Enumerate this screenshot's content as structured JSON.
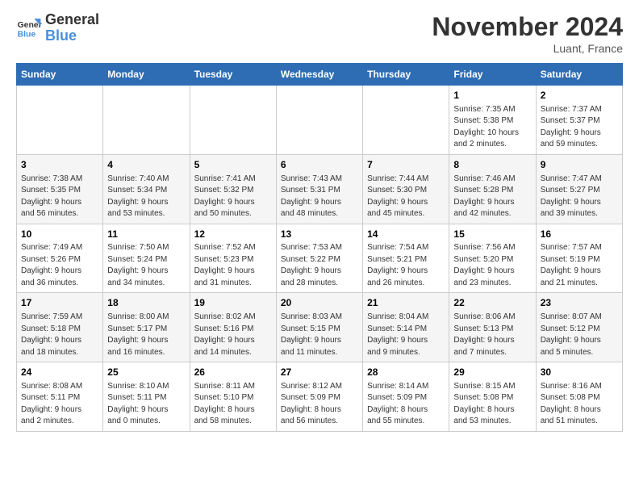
{
  "logo": {
    "line1": "General",
    "line2": "Blue"
  },
  "title": "November 2024",
  "location": "Luant, France",
  "weekdays": [
    "Sunday",
    "Monday",
    "Tuesday",
    "Wednesday",
    "Thursday",
    "Friday",
    "Saturday"
  ],
  "weeks": [
    [
      {
        "day": "",
        "info": ""
      },
      {
        "day": "",
        "info": ""
      },
      {
        "day": "",
        "info": ""
      },
      {
        "day": "",
        "info": ""
      },
      {
        "day": "",
        "info": ""
      },
      {
        "day": "1",
        "info": "Sunrise: 7:35 AM\nSunset: 5:38 PM\nDaylight: 10 hours\nand 2 minutes."
      },
      {
        "day": "2",
        "info": "Sunrise: 7:37 AM\nSunset: 5:37 PM\nDaylight: 9 hours\nand 59 minutes."
      }
    ],
    [
      {
        "day": "3",
        "info": "Sunrise: 7:38 AM\nSunset: 5:35 PM\nDaylight: 9 hours\nand 56 minutes."
      },
      {
        "day": "4",
        "info": "Sunrise: 7:40 AM\nSunset: 5:34 PM\nDaylight: 9 hours\nand 53 minutes."
      },
      {
        "day": "5",
        "info": "Sunrise: 7:41 AM\nSunset: 5:32 PM\nDaylight: 9 hours\nand 50 minutes."
      },
      {
        "day": "6",
        "info": "Sunrise: 7:43 AM\nSunset: 5:31 PM\nDaylight: 9 hours\nand 48 minutes."
      },
      {
        "day": "7",
        "info": "Sunrise: 7:44 AM\nSunset: 5:30 PM\nDaylight: 9 hours\nand 45 minutes."
      },
      {
        "day": "8",
        "info": "Sunrise: 7:46 AM\nSunset: 5:28 PM\nDaylight: 9 hours\nand 42 minutes."
      },
      {
        "day": "9",
        "info": "Sunrise: 7:47 AM\nSunset: 5:27 PM\nDaylight: 9 hours\nand 39 minutes."
      }
    ],
    [
      {
        "day": "10",
        "info": "Sunrise: 7:49 AM\nSunset: 5:26 PM\nDaylight: 9 hours\nand 36 minutes."
      },
      {
        "day": "11",
        "info": "Sunrise: 7:50 AM\nSunset: 5:24 PM\nDaylight: 9 hours\nand 34 minutes."
      },
      {
        "day": "12",
        "info": "Sunrise: 7:52 AM\nSunset: 5:23 PM\nDaylight: 9 hours\nand 31 minutes."
      },
      {
        "day": "13",
        "info": "Sunrise: 7:53 AM\nSunset: 5:22 PM\nDaylight: 9 hours\nand 28 minutes."
      },
      {
        "day": "14",
        "info": "Sunrise: 7:54 AM\nSunset: 5:21 PM\nDaylight: 9 hours\nand 26 minutes."
      },
      {
        "day": "15",
        "info": "Sunrise: 7:56 AM\nSunset: 5:20 PM\nDaylight: 9 hours\nand 23 minutes."
      },
      {
        "day": "16",
        "info": "Sunrise: 7:57 AM\nSunset: 5:19 PM\nDaylight: 9 hours\nand 21 minutes."
      }
    ],
    [
      {
        "day": "17",
        "info": "Sunrise: 7:59 AM\nSunset: 5:18 PM\nDaylight: 9 hours\nand 18 minutes."
      },
      {
        "day": "18",
        "info": "Sunrise: 8:00 AM\nSunset: 5:17 PM\nDaylight: 9 hours\nand 16 minutes."
      },
      {
        "day": "19",
        "info": "Sunrise: 8:02 AM\nSunset: 5:16 PM\nDaylight: 9 hours\nand 14 minutes."
      },
      {
        "day": "20",
        "info": "Sunrise: 8:03 AM\nSunset: 5:15 PM\nDaylight: 9 hours\nand 11 minutes."
      },
      {
        "day": "21",
        "info": "Sunrise: 8:04 AM\nSunset: 5:14 PM\nDaylight: 9 hours\nand 9 minutes."
      },
      {
        "day": "22",
        "info": "Sunrise: 8:06 AM\nSunset: 5:13 PM\nDaylight: 9 hours\nand 7 minutes."
      },
      {
        "day": "23",
        "info": "Sunrise: 8:07 AM\nSunset: 5:12 PM\nDaylight: 9 hours\nand 5 minutes."
      }
    ],
    [
      {
        "day": "24",
        "info": "Sunrise: 8:08 AM\nSunset: 5:11 PM\nDaylight: 9 hours\nand 2 minutes."
      },
      {
        "day": "25",
        "info": "Sunrise: 8:10 AM\nSunset: 5:11 PM\nDaylight: 9 hours\nand 0 minutes."
      },
      {
        "day": "26",
        "info": "Sunrise: 8:11 AM\nSunset: 5:10 PM\nDaylight: 8 hours\nand 58 minutes."
      },
      {
        "day": "27",
        "info": "Sunrise: 8:12 AM\nSunset: 5:09 PM\nDaylight: 8 hours\nand 56 minutes."
      },
      {
        "day": "28",
        "info": "Sunrise: 8:14 AM\nSunset: 5:09 PM\nDaylight: 8 hours\nand 55 minutes."
      },
      {
        "day": "29",
        "info": "Sunrise: 8:15 AM\nSunset: 5:08 PM\nDaylight: 8 hours\nand 53 minutes."
      },
      {
        "day": "30",
        "info": "Sunrise: 8:16 AM\nSunset: 5:08 PM\nDaylight: 8 hours\nand 51 minutes."
      }
    ]
  ]
}
